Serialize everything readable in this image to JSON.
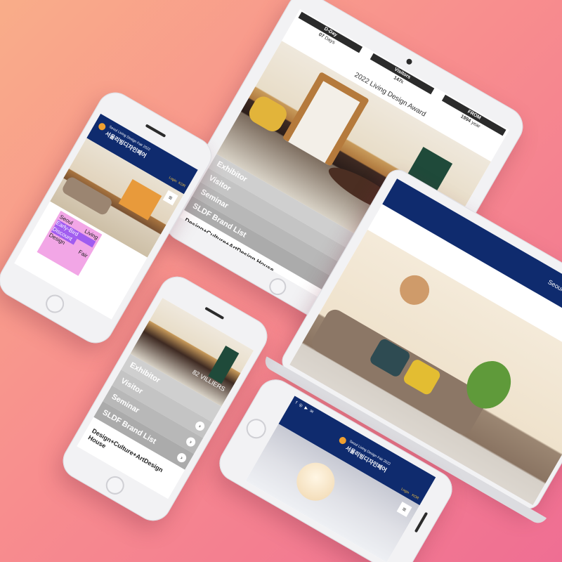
{
  "site": {
    "name_en": "Seoul Living Design Fair 2022",
    "name_kr": "서울리빙디자인페어",
    "login": "Login",
    "lang": "KOR",
    "menu_icon": "hamburger-icon"
  },
  "stats": {
    "dday_label": "D-Day",
    "dday_value": "07",
    "dday_unit": "Days",
    "visitors_label": "Visitors",
    "visitors_value": "147",
    "visitors_unit": "k",
    "from_label": "FROM",
    "from_value": "1994",
    "from_unit": "year"
  },
  "award_title": "2022 Living Design Award",
  "brand_overlay": "82 VILLIERS",
  "menu": [
    "Exhibitor",
    "Visitor",
    "Seminar",
    "SLDF Brand List"
  ],
  "arrow_glyph": "›",
  "footer_heading": "Design+Culture+ArtDesign House",
  "footer_heading_line1": "Design+Culture+ArtDesign",
  "footer_heading_line2": "House",
  "poster": {
    "w1": "Seoul",
    "w2": "Living",
    "w3": "Early-Bird",
    "w4": "Discount",
    "w5": "Design",
    "w6": "Fair",
    "bg": "#f2a6e6",
    "accent": "#a05cf0"
  },
  "colors": {
    "nav": "#0f2b6e",
    "gray_menu": "#c4c4c4",
    "dark_bar": "#2b2b2b"
  },
  "social_icons": [
    "facebook-icon",
    "instagram-icon",
    "youtube-icon",
    "mail-icon"
  ]
}
